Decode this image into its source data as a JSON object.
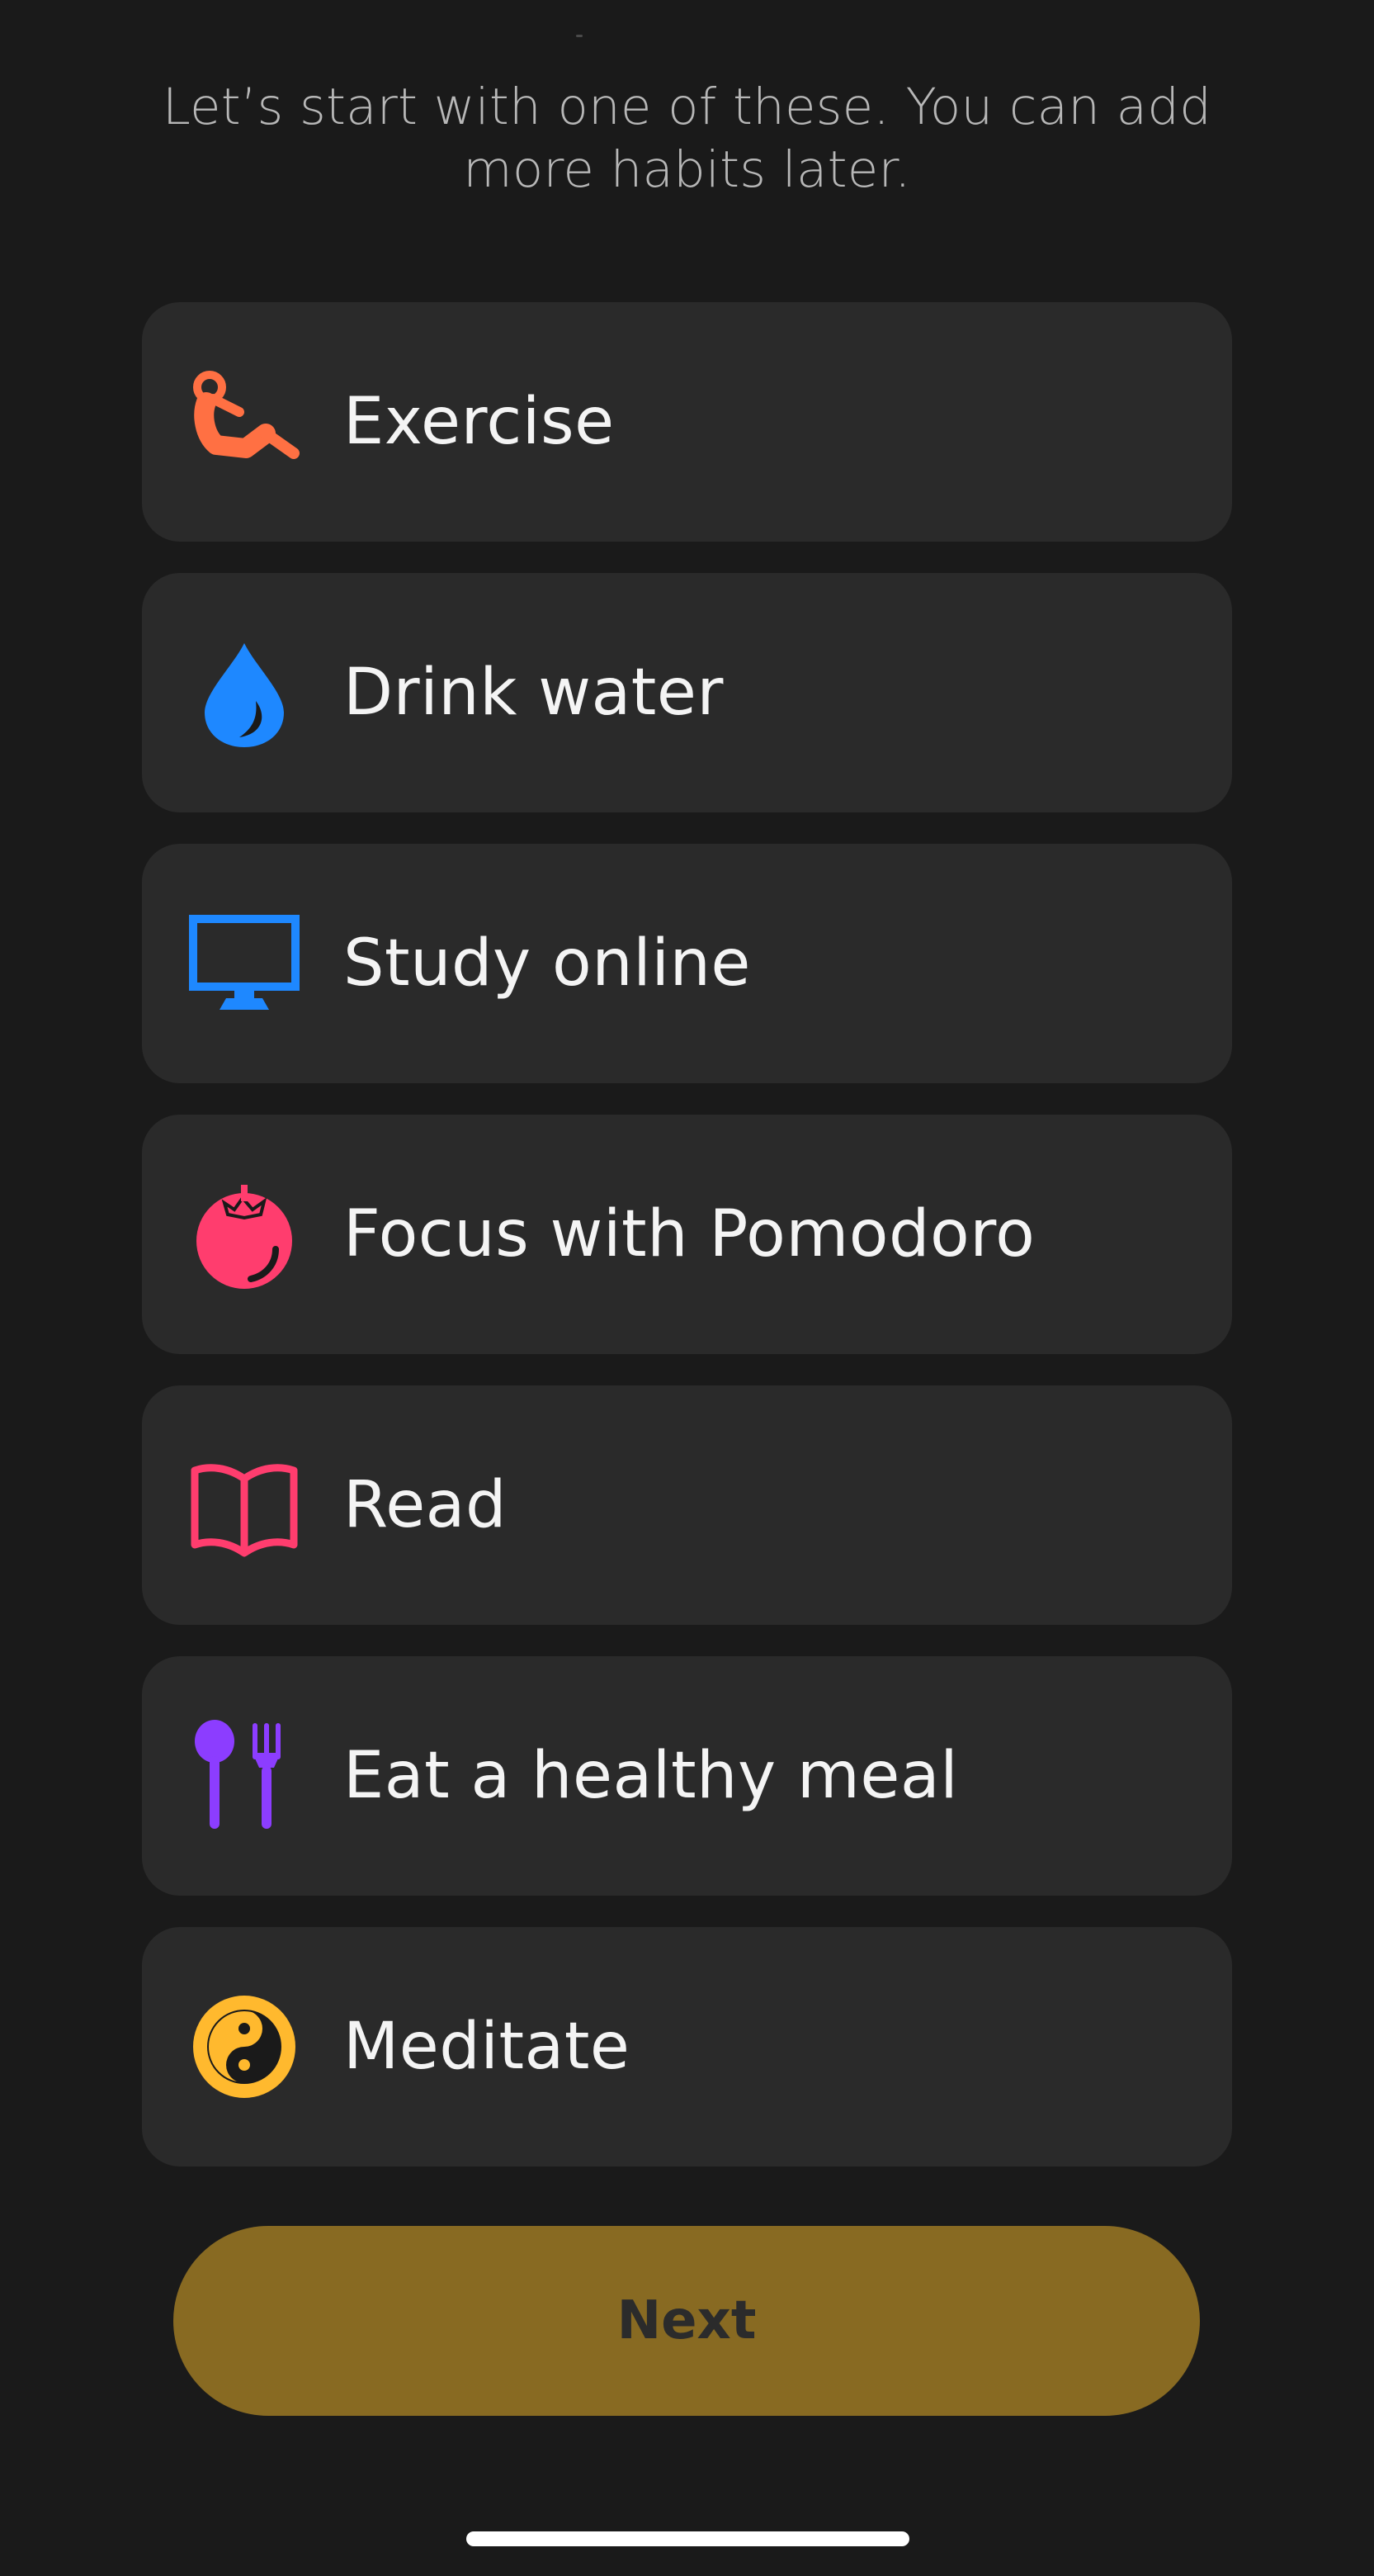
{
  "intro_text": "Let’s start with one of these. You can add more habits later.",
  "habits": [
    {
      "label": "Exercise",
      "icon": "exercise-icon",
      "color": "#ff7043"
    },
    {
      "label": "Drink water",
      "icon": "water-drop-icon",
      "color": "#1e88ff"
    },
    {
      "label": "Study online",
      "icon": "monitor-icon",
      "color": "#1e88ff"
    },
    {
      "label": "Focus with Pomodoro",
      "icon": "tomato-icon",
      "color": "#ff3d6e"
    },
    {
      "label": "Read",
      "icon": "book-icon",
      "color": "#ff3d6e"
    },
    {
      "label": "Eat a healthy meal",
      "icon": "fork-spoon-icon",
      "color": "#8c3dff"
    },
    {
      "label": "Meditate",
      "icon": "yin-yang-icon",
      "color": "#ffb92e"
    }
  ],
  "next_button": {
    "label": "Next",
    "color": "#886a22"
  }
}
